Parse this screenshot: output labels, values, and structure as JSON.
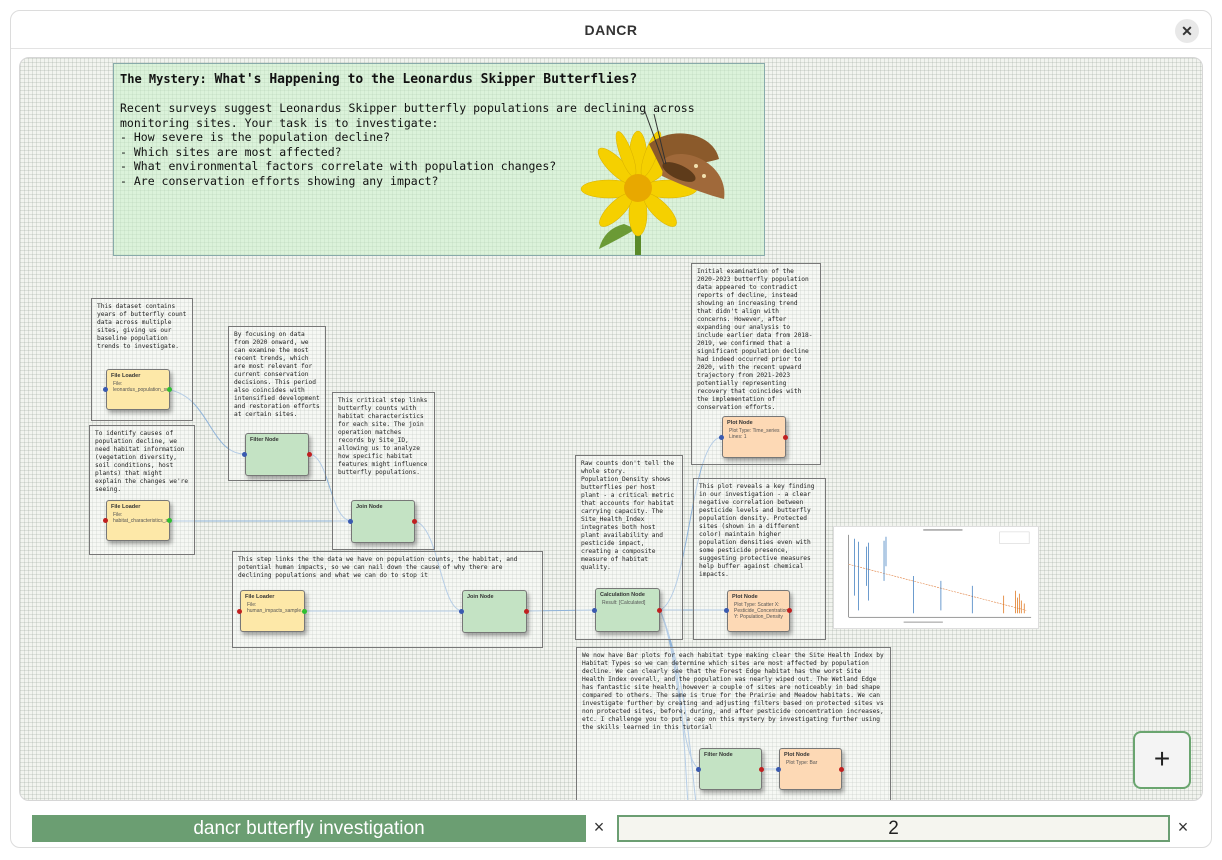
{
  "window": {
    "title": "DANCR",
    "close_icon": "close-icon"
  },
  "mystery": {
    "title_prefix": "The Mystery:",
    "title": "What's Happening to the Leonardus Skipper Butterflies?",
    "intro": "Recent surveys suggest Leonardus Skipper butterfly populations are declining across\nmonitoring sites. Your task is to investigate:\n- How severe is the population decline?\n- Which sites are most affected?\n- What environmental factors correlate with population changes?\n- Are conservation efforts showing any impact?"
  },
  "notes": {
    "dataset": "This dataset contains years of butterfly count data across multiple sites, giving us our baseline population trends to investigate.",
    "focus": "By focusing on data from 2020 onward, we can examine the most recent trends, which are most relevant for current conservation decisions. This period also coincides with intensified development and restoration efforts at certain sites.",
    "join": "This critical step links butterfly counts with habitat characteristics for each site. The join operation matches records by Site_ID, allowing us to analyze how specific habitat features might influence butterfly populations.",
    "habitat": "To identify causes of population decline, we need habitat information (vegetation diversity, soil conditions, host plants) that might explain the changes we're seeing.",
    "impacts": "This step links the the data we have on population counts, the habitat, and potential human impacts, so we can nail down the cause of why there are declining populations and what we can do to stop it",
    "raw": "Raw counts don't tell the whole story. Population_Density shows butterflies per host plant - a critical metric that accounts for habitat carrying capacity. The Site_Health_Index integrates both host plant availability and pesticide impact, creating a composite measure of habitat quality.",
    "initial": "Initial examination of the 2020-2023 butterfly population data appeared to contradict reports of decline, instead showing an increasing trend that didn't align with concerns. However, after expanding our analysis to include earlier data from 2018-2019, we confirmed that a significant population decline had indeed occurred prior to 2020, with the recent upward trajectory from 2021-2023 potentially representing recovery that coincides with the implementation of conservation efforts.",
    "key_finding": "This plot reveals a key finding in our investigation - a clear negative correlation between pesticide levels and butterfly population density. Protected sites (shown in a different color) maintain higher population densities even with some pesticide presence, suggesting protective measures help buffer against chemical impacts.",
    "bar_plots": "We now have Bar plots for each habitat type making clear the Site Health Index by Habitat Types so we can determine which sites are most affected by population decline. We can clearly see that the Forest Edge habitat has the worst Site Health Index overall, and the population was nearly wiped out. The Wetland Edge has fantastic site health, however a couple of sites are noticeably in bad shape compared to others. The same is true for the Prairie and Meadow habitats. We can investigate further by creating and adjusting filters based on protected sites vs non protected sites, before, during, and after pesticide concentration increases, etc. I challenge you to put a cap on this mystery by investigating further using the skills learned in this tutorial"
  },
  "nodes": {
    "file1": {
      "title": "File Loader",
      "detail": "File: leonardus_population_surveys_sample.csv"
    },
    "filter1": {
      "title": "Filter Node",
      "detail": ""
    },
    "join1": {
      "title": "Join Node",
      "detail": ""
    },
    "file2": {
      "title": "File Loader",
      "detail": "File: habitat_characteristics_sample.csv"
    },
    "file3": {
      "title": "File Loader",
      "detail": "File: human_impacts_sample.csv"
    },
    "join2": {
      "title": "Join Node",
      "detail": ""
    },
    "calc": {
      "title": "Calculation Node",
      "detail": "Result: [Calculated]"
    },
    "plot1": {
      "title": "Plot Node",
      "detail": "Plot Type: Time_series Lines: 1"
    },
    "plot2": {
      "title": "Plot Node",
      "detail": "Plot Type: Scatter X: Pesticide_Concentration Y: Population_Density"
    },
    "filter2": {
      "title": "Filter Node",
      "detail": ""
    },
    "plot3": {
      "title": "Plot Node",
      "detail": "Plot Type: Bar"
    }
  },
  "add_button": {
    "label": "+"
  },
  "tabs": [
    {
      "label": "dancr butterfly investigation",
      "close": "×"
    },
    {
      "label": "2",
      "close": "×"
    }
  ]
}
